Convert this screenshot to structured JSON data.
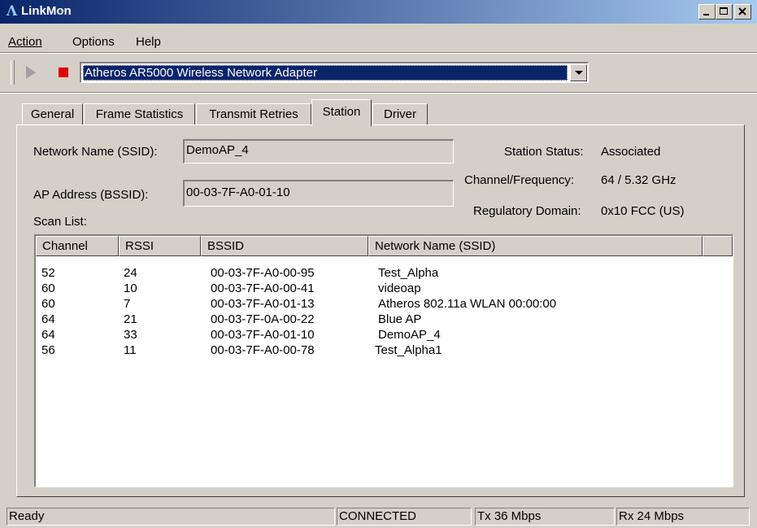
{
  "window": {
    "title": "LinkMon"
  },
  "menu": [
    {
      "label": "Action"
    },
    {
      "label": "Options"
    },
    {
      "label": "Help"
    }
  ],
  "toolbar": {
    "adapter": "Atheros AR5000 Wireless Network Adapter"
  },
  "tabs": [
    {
      "label": "General"
    },
    {
      "label": "Frame Statistics"
    },
    {
      "label": "Transmit Retries"
    },
    {
      "label": "Station"
    },
    {
      "label": "Driver"
    }
  ],
  "active_tab": "Station",
  "station": {
    "ssid_label": "Network Name (SSID):",
    "ssid_value": "DemoAP_4",
    "bssid_label": "AP Address (BSSID):",
    "bssid_value": "00-03-7F-A0-01-10",
    "status_label": "Station Status:",
    "status_value": "Associated",
    "channel_label": "Channel/Frequency:",
    "channel_value": "64 / 5.32 GHz",
    "domain_label": "Regulatory Domain:",
    "domain_value": "0x10 FCC (US)",
    "scan_label": "Scan List:"
  },
  "scan_list": {
    "columns": [
      "Channel",
      "RSSI",
      "BSSID",
      "Network Name (SSID)"
    ],
    "rows": [
      [
        "52",
        "24",
        "00-03-7F-A0-00-95",
        "Test_Alpha"
      ],
      [
        "60",
        "10",
        "00-03-7F-A0-00-41",
        "videoap"
      ],
      [
        "60",
        "7",
        "00-03-7F-A0-01-13",
        "Atheros 802.11a WLAN 00:00:00"
      ],
      [
        "64",
        "21",
        "00-03-7F-0A-00-22",
        "Blue AP"
      ],
      [
        "64",
        "33",
        "00-03-7F-A0-01-10",
        "DemoAP_4"
      ],
      [
        "56",
        "11",
        "00-03-7F-A0-00-78",
        "Test_Alpha1"
      ]
    ]
  },
  "statusbar": {
    "ready": "Ready",
    "connection": "CONNECTED",
    "tx": "Tx 36 Mbps",
    "rx": "Rx 24 Mbps"
  },
  "colors": {
    "titlebar_start": "#0a246a",
    "titlebar_end": "#a6caf0",
    "stop": "#e00000",
    "face": "#d4d0c8"
  }
}
